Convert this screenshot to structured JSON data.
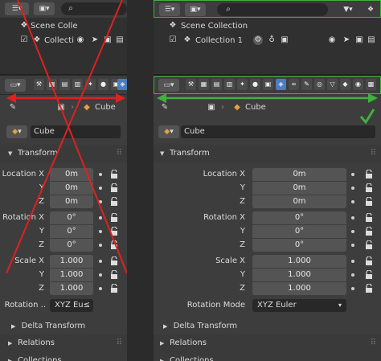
{
  "left": {
    "outliner": {
      "scene": "Scene Colle",
      "collection": "Collecti"
    },
    "breadcrumb": {
      "object": "Cube"
    },
    "object_name": "Cube",
    "transform": {
      "title": "Transform",
      "location": {
        "label_x": "Location X",
        "label_y": "Y",
        "label_z": "Z",
        "x": "0m",
        "y": "0m",
        "z": "0m"
      },
      "rotation": {
        "label_x": "Rotation X",
        "label_y": "Y",
        "label_z": "Z",
        "x": "0°",
        "y": "0°",
        "z": "0°"
      },
      "scale": {
        "label_x": "Scale X",
        "label_y": "Y",
        "label_z": "Z",
        "x": "1.000",
        "y": "1.000",
        "z": "1.000"
      },
      "rotation_mode_label": "Rotation ..",
      "rotation_mode_value": "XYZ Eu≤"
    },
    "sections": {
      "delta": "Delta Transform",
      "relations": "Relations",
      "collections": "Collections"
    }
  },
  "right": {
    "outliner": {
      "scene": "Scene Collection",
      "collection": "Collection 1"
    },
    "breadcrumb": {
      "object": "Cube"
    },
    "object_name": "Cube",
    "transform": {
      "title": "Transform",
      "location": {
        "label_x": "Location X",
        "label_y": "Y",
        "label_z": "Z",
        "x": "0m",
        "y": "0m",
        "z": "0m"
      },
      "rotation": {
        "label_x": "Rotation X",
        "label_y": "Y",
        "label_z": "Z",
        "x": "0°",
        "y": "0°",
        "z": "0°"
      },
      "scale": {
        "label_x": "Scale X",
        "label_y": "Y",
        "label_z": "Z",
        "x": "1.000",
        "y": "1.000",
        "z": "1.000"
      },
      "rotation_mode_label": "Rotation Mode",
      "rotation_mode_value": "XYZ Euler"
    },
    "sections": {
      "delta": "Delta Transform",
      "relations": "Relations",
      "collections": "Collections"
    }
  },
  "colors": {
    "cross": "#e02020",
    "arrow_red": "#e02020",
    "arrow_green": "#3fb13f",
    "check": "#3fb13f",
    "tab_active": "#4c7cc0"
  },
  "icons": [
    "outliner-icon",
    "viewlayer-icon",
    "search-icon",
    "filter-icon",
    "eye-icon",
    "pointer-icon",
    "camera-icon",
    "properties-icon",
    "object-cube-icon",
    "checkmark-icon",
    "lock-icon",
    "keyframe-dot-icon"
  ]
}
